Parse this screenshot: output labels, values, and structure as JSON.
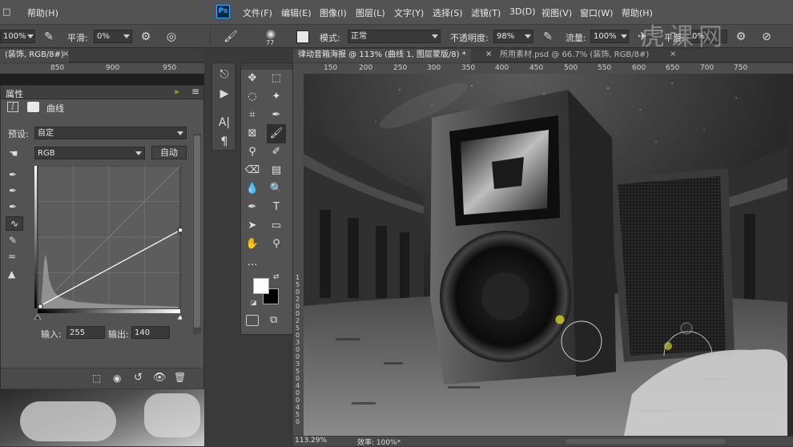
{
  "menubar": {
    "left_help": "帮助(H)",
    "items": [
      "文件(F)",
      "编辑(E)",
      "图像(I)",
      "图层(L)",
      "文字(Y)",
      "选择(S)",
      "滤镜(T)",
      "3D(D)",
      "视图(V)",
      "窗口(W)",
      "帮助(H)"
    ],
    "ps_logo": "Ps"
  },
  "options_left": {
    "zoom": "100%",
    "smooth_label": "平滑:",
    "smooth_value": "0%"
  },
  "options_right": {
    "brush_size": "77",
    "mode_label": "模式:",
    "mode_value": "正常",
    "opacity_label": "不透明度:",
    "opacity_value": "98%",
    "flow_label": "流量:",
    "flow_value": "100%",
    "smooth_label": "平滑:",
    "smooth_value": "0%"
  },
  "tabs": {
    "left_doc": "(装饰, RGB/8#)",
    "active": "律动音箱海报 @ 113% (曲线 1, 图层蒙版/8) *",
    "inactive": "所用素材.psd @ 66.7% (装饰, RGB/8#)"
  },
  "ruler_left": [
    "850",
    "900",
    "950"
  ],
  "ruler_top": [
    "150",
    "200",
    "250",
    "300",
    "350",
    "400",
    "450",
    "500",
    "550",
    "600",
    "650",
    "700",
    "750"
  ],
  "ruler_vert": [
    "1",
    "5",
    "0",
    "2",
    "0",
    "0",
    "2",
    "5",
    "0",
    "3",
    "0",
    "0",
    "3",
    "5",
    "0",
    "4",
    "0",
    "0",
    "4",
    "5",
    "0"
  ],
  "properties": {
    "title": "属性",
    "type": "曲线",
    "preset_label": "预设:",
    "preset_value": "自定",
    "channel": "RGB",
    "auto_button": "自动",
    "input_label": "输入:",
    "input_value": "255",
    "output_label": "输出:",
    "output_value": "140"
  },
  "curve": {
    "point_input": 255,
    "point_output": 140
  },
  "status": {
    "zoom": "113.29%",
    "efficiency": "效率: 100%*"
  },
  "watermark": "虎课网",
  "colors": {
    "foreground": "#ffffff",
    "background": "#000000",
    "accent": "#2d8ceb"
  },
  "icons": {
    "tools": [
      "move-icon",
      "marquee-icon",
      "lasso-icon",
      "magic-wand-icon",
      "crop-icon",
      "eyedropper-icon",
      "frame-icon",
      "brush-icon",
      "stamp-icon",
      "history-brush-icon",
      "eraser-icon",
      "gradient-icon",
      "blur-icon",
      "dodge-icon",
      "pen-icon",
      "type-icon",
      "path-select-icon",
      "rectangle-icon",
      "hand-icon",
      "zoom-icon",
      "more-icon"
    ]
  }
}
